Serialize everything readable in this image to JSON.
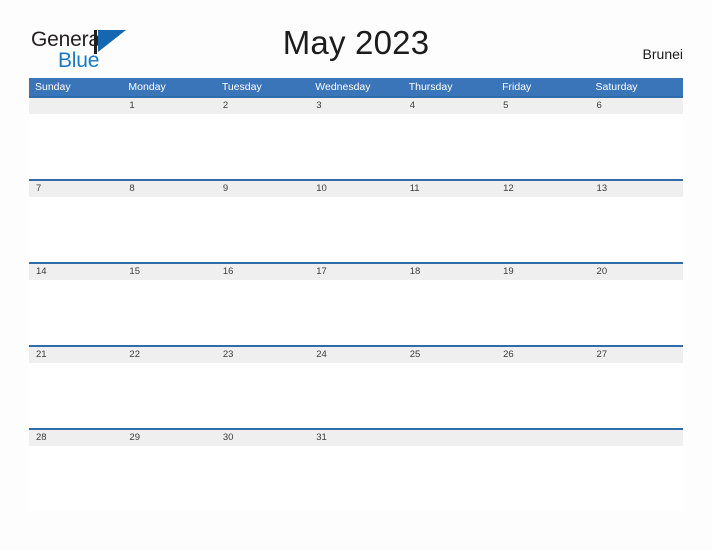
{
  "brand": {
    "name_part1": "General",
    "name_part2": "Blue",
    "mark_icon": "flag-triangle-icon",
    "accent_color": "#1a7bc4"
  },
  "header": {
    "title": "May 2023",
    "country": "Brunei",
    "header_bg_color": "#3a75ba",
    "date_strip_color": "#efefef",
    "row_border_color": "#2e6da8"
  },
  "calendar": {
    "weekdays": [
      "Sunday",
      "Monday",
      "Tuesday",
      "Wednesday",
      "Thursday",
      "Friday",
      "Saturday"
    ],
    "weeks": [
      [
        "",
        "1",
        "2",
        "3",
        "4",
        "5",
        "6"
      ],
      [
        "7",
        "8",
        "9",
        "10",
        "11",
        "12",
        "13"
      ],
      [
        "14",
        "15",
        "16",
        "17",
        "18",
        "19",
        "20"
      ],
      [
        "21",
        "22",
        "23",
        "24",
        "25",
        "26",
        "27"
      ],
      [
        "28",
        "29",
        "30",
        "31",
        "",
        "",
        ""
      ]
    ]
  }
}
